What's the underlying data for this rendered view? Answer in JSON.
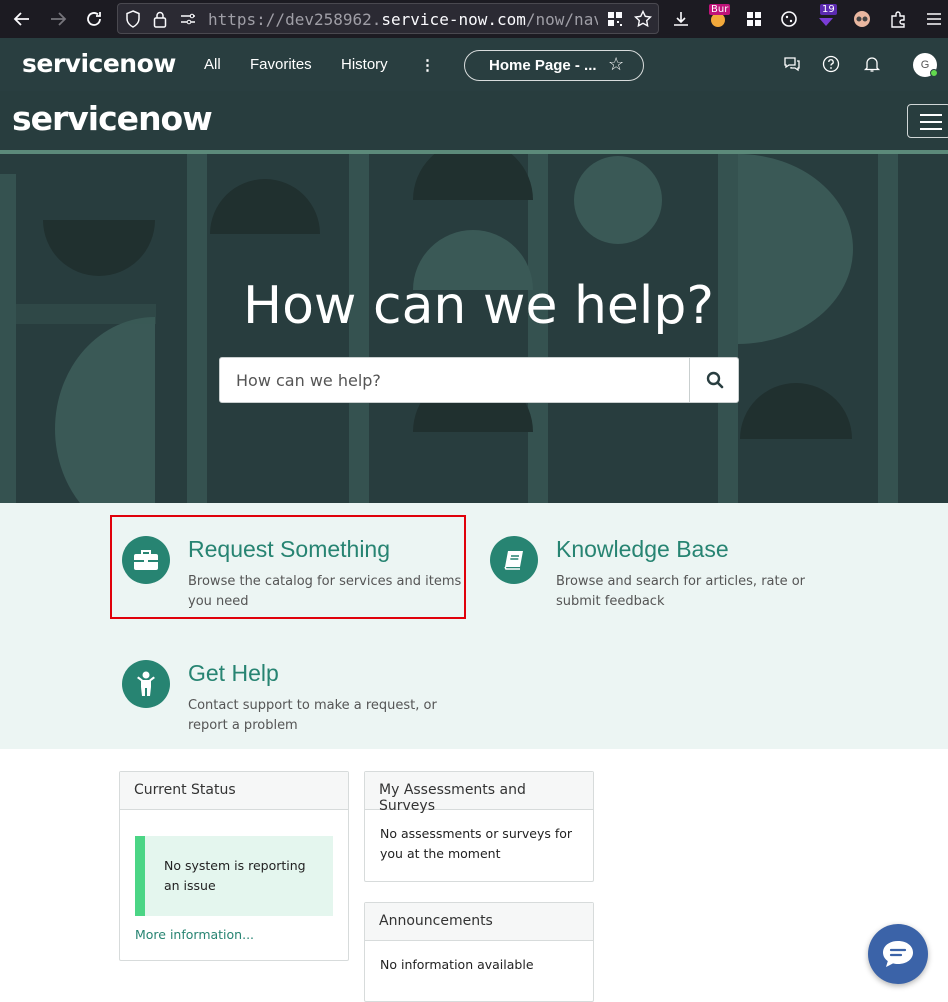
{
  "browser": {
    "url_dim_prefix": "https://dev258962.",
    "url_domain": "service-now.com",
    "url_suffix": "/now/nav",
    "extension_badge_1": "Bur",
    "extension_badge_2": "19"
  },
  "nav": {
    "logo": "servicenow",
    "all_label": "All",
    "favorites_label": "Favorites",
    "history_label": "History",
    "more_label": "⋮",
    "pill_label": "Home Page - ...",
    "avatar_initial": "G"
  },
  "portal": {
    "logo": "servicenow",
    "hero_title": "How can we help?",
    "search_placeholder": "How can we help?"
  },
  "cards": [
    {
      "title": "Request Something",
      "desc": "Browse the catalog for services and items you need"
    },
    {
      "title": "Knowledge Base",
      "desc": "Browse and search for articles, rate or submit feedback"
    },
    {
      "title": "Get Help",
      "desc": "Contact support to make a request, or report a problem"
    }
  ],
  "widgets": {
    "current_status": {
      "title": "Current Status",
      "status_text": "No system is reporting an issue",
      "more_link": "More information..."
    },
    "assessments": {
      "title": "My Assessments and Surveys",
      "body": "No assessments or surveys for you at the moment"
    },
    "announcements": {
      "title": "Announcements",
      "body": "No information available"
    }
  },
  "colors": {
    "nav_bg": "#293e40",
    "accent": "#278472",
    "status_green": "#4bd585",
    "highlight": "#e0000a",
    "chat_blue": "#3b63a8"
  }
}
